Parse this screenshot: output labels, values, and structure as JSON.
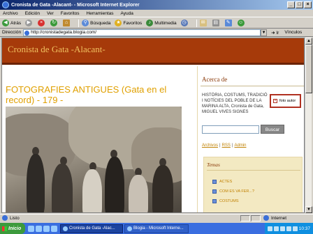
{
  "window": {
    "title": "Cronista de Gata -Alacant- - Microsoft Internet Explorer",
    "minimize": "_",
    "maximize": "□",
    "close": "×"
  },
  "menu": [
    "Archivo",
    "Edición",
    "Ver",
    "Favoritos",
    "Herramientas",
    "Ayuda"
  ],
  "toolbar": {
    "back_label": "Atrás",
    "search_label": "Búsqueda",
    "favorites_label": "Favoritos",
    "multimedia_label": "Multimedia"
  },
  "address": {
    "label": "Dirección",
    "url": "http://cronistadegata.blogia.com/",
    "go_label": "Ir",
    "links_label": "Vínculos"
  },
  "blog": {
    "title": "Cronista de Gata -Alacant-",
    "post_title": "FOTOGRAFIES ANTIGUES (Gata en el record) - 179 -"
  },
  "sidebar": {
    "about_heading": "Acerca de",
    "about_text": "HISTÒRIA, COSTUMS, TRADICIÓ I NOTÍCIES DEL POBLE DE LA MARINA ALTA, Cronista de Gata, MIGUEL VIVES SIGNES",
    "photo_btn": "foto autor",
    "search_btn": "Buscar",
    "links": [
      "Archivos",
      "RSS",
      "Admin"
    ],
    "temas_heading": "Temas",
    "temas": [
      "ACTES",
      "COM ES VA FER...?",
      "COSTUMS"
    ]
  },
  "status": {
    "text": "Listo",
    "zone": "Internet"
  },
  "taskbar": {
    "start": "Inicio",
    "tasks": [
      "Cronista de Gata -Alac...",
      "Blogia - Microsoft Interne..."
    ],
    "clock": "10:37"
  }
}
